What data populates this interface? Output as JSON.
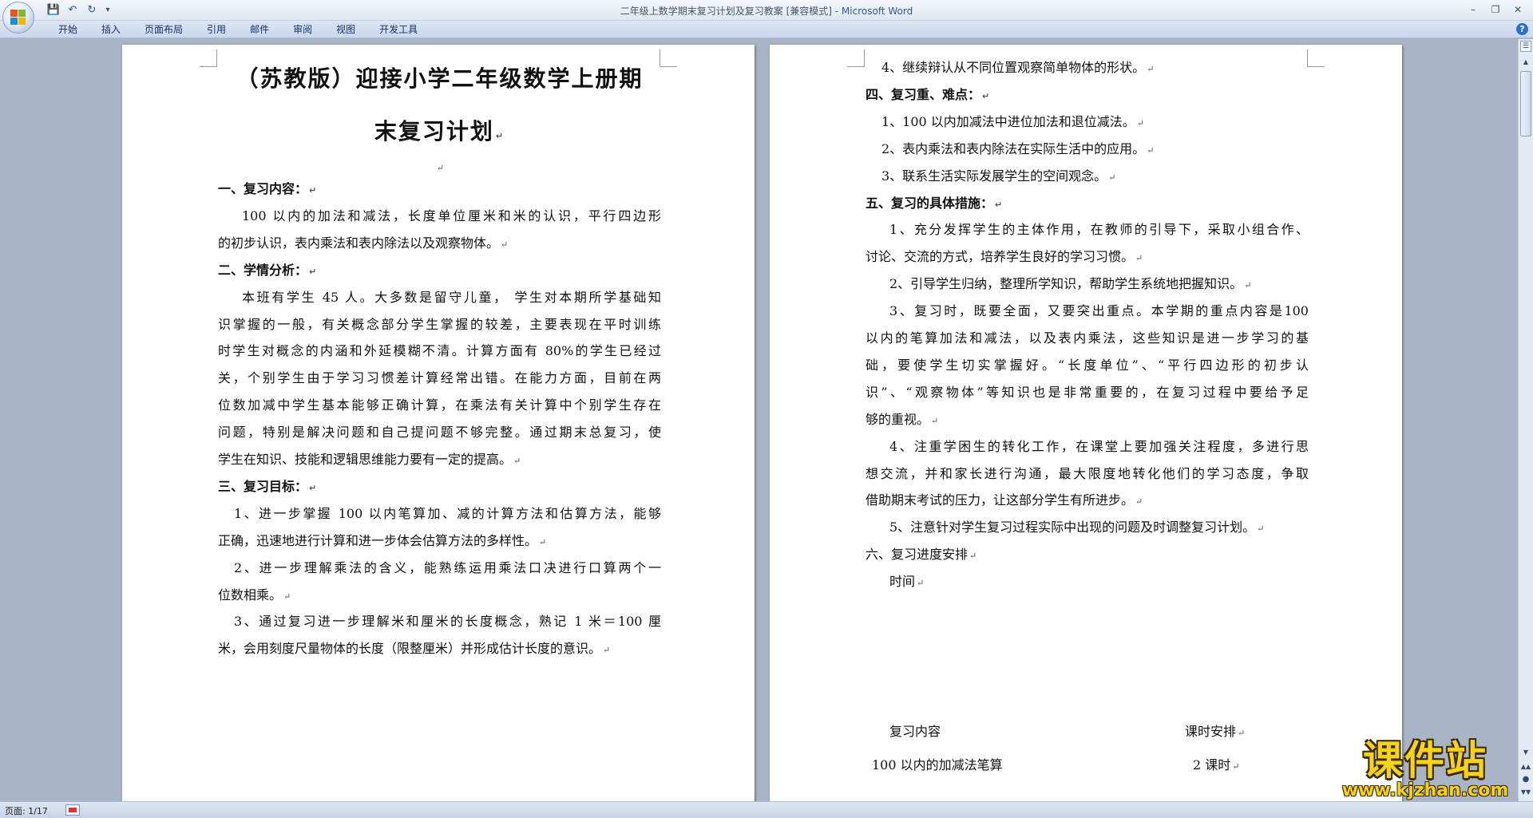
{
  "window": {
    "title": "二年级上数学期末复习计划及复习教案 [兼容模式] - ",
    "app": "Microsoft Word",
    "controls": [
      "–",
      "❐",
      "✕"
    ]
  },
  "qat": {
    "save": "💾",
    "undo": "↶",
    "redo": "↻",
    "more": "▾"
  },
  "ribbon": {
    "tabs": [
      "开始",
      "插入",
      "页面布局",
      "引用",
      "邮件",
      "审阅",
      "视图",
      "开发工具"
    ],
    "help": "?"
  },
  "marks": {
    "para": "↵"
  },
  "left_page": {
    "title_line1": "（苏教版）迎接小学二年级数学上册期",
    "title_line2": "末复习计划",
    "lines": [
      {
        "text": "一、复习内容：",
        "type": "h"
      },
      {
        "text": "100 以内的加法和减法，长度单位厘米和米的认识，平行四边形",
        "type": "ind1 justify"
      },
      {
        "text": "的初步认识，表内乘法和表内除法以及观察物体。",
        "type": "p"
      },
      {
        "text": "二、学情分析：",
        "type": "h"
      },
      {
        "text": "本班有学生 45 人。大多数是留守儿童，  学生对本期所学基础知",
        "type": "ind1 justify"
      },
      {
        "text": "识掌握的一般，有关概念部分学生掌握的较差，主要表现在平时训练",
        "type": "justify"
      },
      {
        "text": "时学生对概念的内涵和外延模糊不清。计算方面有 80%的学生已经过",
        "type": "justify"
      },
      {
        "text": "关，个别学生由于学习习惯差计算经常出错。在能力方面，目前在两",
        "type": "justify"
      },
      {
        "text": "位数加减中学生基本能够正确计算，在乘法有关计算中个别学生存在",
        "type": "justify"
      },
      {
        "text": "问题，特别是解决问题和自己提问题不够完整。通过期末总复习，使",
        "type": "justify"
      },
      {
        "text": "学生在知识、技能和逻辑思维能力要有一定的提高。",
        "type": "p"
      },
      {
        "text": "三、复习目标：",
        "type": "h"
      },
      {
        "text": "1、进一步掌握 100 以内笔算加、减的计算方法和估算方法，能够",
        "type": "ind2 justify"
      },
      {
        "text": "正确，迅速地进行计算和进一步体会估算方法的多样性。",
        "type": "p"
      },
      {
        "text": "2、进一步理解乘法的含义，能熟练运用乘法口决进行口算两个一",
        "type": "ind2 justify"
      },
      {
        "text": "位数相乘。",
        "type": "p"
      },
      {
        "text": "3、通过复习进一步理解米和厘米的长度概念，熟记 1 米＝100 厘",
        "type": "ind2 justify"
      },
      {
        "text": "米，会用刻度尺量物体的长度（限整厘米）并形成估计长度的意识。",
        "type": "p"
      }
    ]
  },
  "right_page": {
    "lines": [
      {
        "text": "4、继续辩认从不同位置观察简单物体的形状。",
        "type": "ind2"
      },
      {
        "text": "四、复习重、难点：",
        "type": "h"
      },
      {
        "text": "1、100 以内加减法中进位加法和退位减法。",
        "type": "ind2"
      },
      {
        "text": "2、表内乘法和表内除法在实际生活中的应用。",
        "type": "ind2"
      },
      {
        "text": "3、联系生活实际发展学生的空间观念。",
        "type": "ind2"
      },
      {
        "text": "五、复习的具体措施：",
        "type": "h"
      },
      {
        "text": "1、充分发挥学生的主体作用，在教师的引导下，采取小组合作、",
        "type": "ind1 justify"
      },
      {
        "text": "讨论、交流的方式，培养学生良好的学习习惯。",
        "type": "p"
      },
      {
        "text": "2、引导学生归纳，整理所学知识，帮助学生系统地把握知识。",
        "type": "ind1"
      },
      {
        "text": "3、复习时，既要全面，又要突出重点。本学期的重点内容是100",
        "type": "ind1 justify"
      },
      {
        "text": "以内的笔算加法和减法，以及表内乘法，这些知识是进一步学习的基",
        "type": "justify"
      },
      {
        "text": "础，要使学生切实掌握好。“长度单位”、“平行四边形的初步认",
        "type": "justify"
      },
      {
        "text": "识”、“观察物体”等知识也是非常重要的，在复习过程中要给予足",
        "type": "justify"
      },
      {
        "text": "够的重视。",
        "type": "p"
      },
      {
        "text": "4、注重学困生的转化工作，在课堂上要加强关注程度，多进行思",
        "type": "ind1 justify"
      },
      {
        "text": "想交流，并和家长进行沟通，最大限度地转化他们的学习态度，争取",
        "type": "justify"
      },
      {
        "text": "借助期末考试的压力，让这部分学生有所进步。",
        "type": "p"
      },
      {
        "text": "5、注意针对学生复习过程实际中出现的问题及时调整复习计划。",
        "type": "ind1"
      },
      {
        "text": "六、复习进度安排",
        "type": "p"
      },
      {
        "text": "时间",
        "type": "ind1"
      }
    ],
    "schedule": {
      "col_content": "复习内容",
      "col_hours": "课时安排",
      "row1_content": "100 以内的加减法笔算",
      "row1_hours": "2 课时"
    }
  },
  "status": {
    "page": "页面: 1/17"
  },
  "scrollbar": {
    "up": "▲",
    "down": "▼",
    "prev": "▲▲",
    "browse": "●",
    "next": "▼▼",
    "ruler": "☰"
  },
  "watermark": {
    "brand": "课件站",
    "url": "www.kjzhan.com"
  }
}
